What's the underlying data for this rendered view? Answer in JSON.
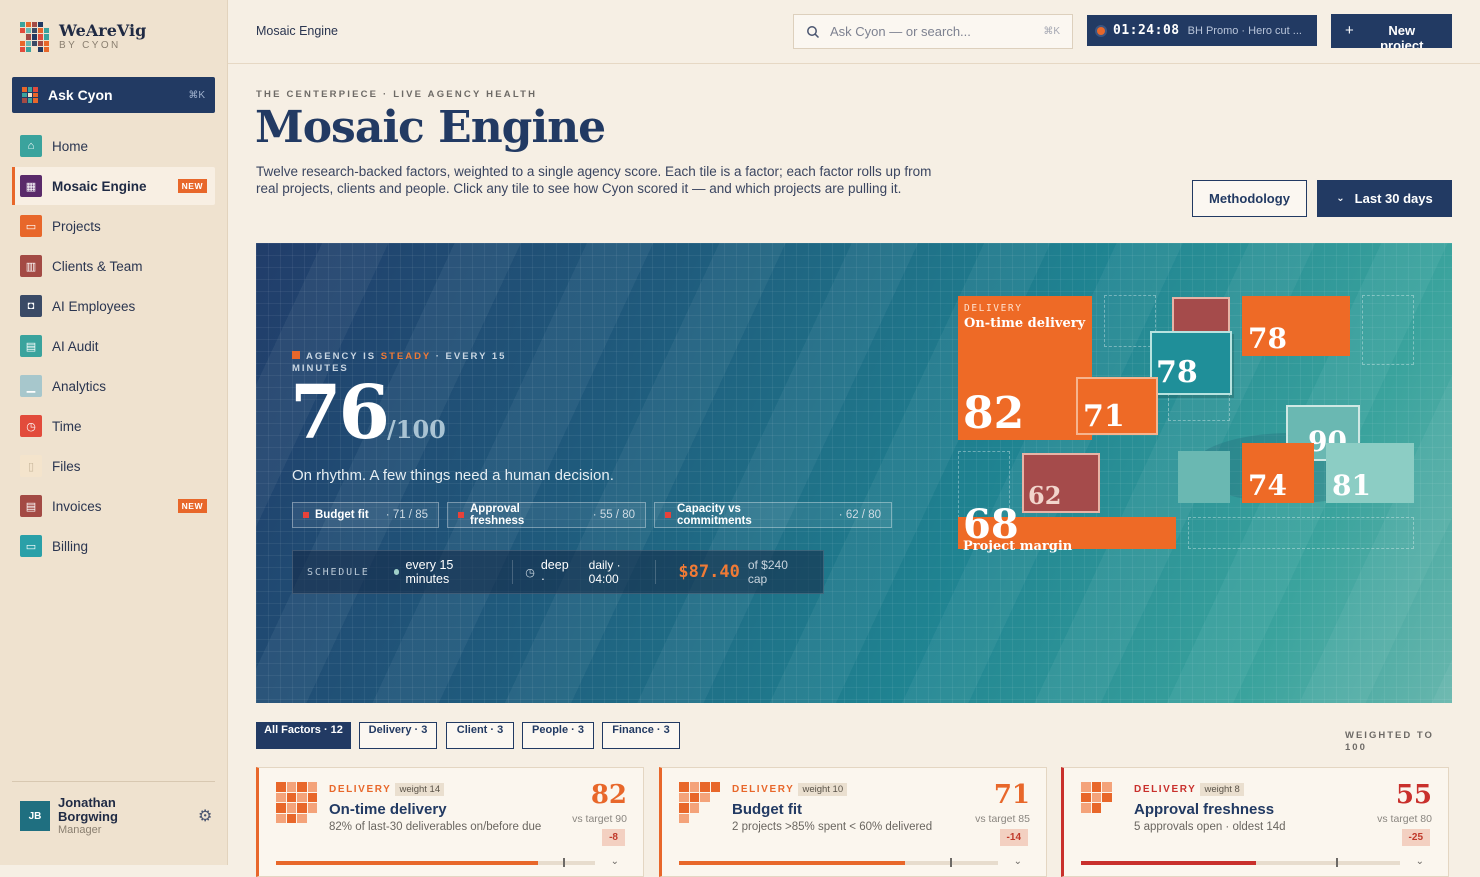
{
  "brand": {
    "name": "WeAreVig",
    "sub": "BY CYON"
  },
  "ask": {
    "label": "Ask Cyon",
    "shortcut": "⌘K"
  },
  "nav": [
    {
      "label": "Home",
      "icon": "home-icon",
      "color": "#3aa39d"
    },
    {
      "label": "Mosaic Engine",
      "icon": "grid-icon",
      "color": "#5a2a6a",
      "badge": "NEW",
      "active": true
    },
    {
      "label": "Projects",
      "icon": "folder-icon",
      "color": "#e8672a"
    },
    {
      "label": "Clients & Team",
      "icon": "building-icon",
      "color": "#a34a44"
    },
    {
      "label": "AI Employees",
      "icon": "robot-icon",
      "color": "#3a4a66"
    },
    {
      "label": "AI Audit",
      "icon": "audit-icon",
      "color": "#3aa39d"
    },
    {
      "label": "Analytics",
      "icon": "chart-icon",
      "color": "#a7c7cc"
    },
    {
      "label": "Time",
      "icon": "clock-icon",
      "color": "#e24b3b"
    },
    {
      "label": "Files",
      "icon": "file-icon",
      "color": "#f4e4cc"
    },
    {
      "label": "Invoices",
      "icon": "invoice-icon",
      "color": "#a34a44",
      "badge": "NEW"
    },
    {
      "label": "Billing",
      "icon": "card-icon",
      "color": "#2aa0a8"
    }
  ],
  "user": {
    "initials": "JB",
    "name": "Jonathan Borgwing",
    "role": "Manager"
  },
  "topbar": {
    "breadcrumb": "Mosaic Engine",
    "search_placeholder": "Ask Cyon — or search...",
    "search_shortcut": "⌘K",
    "timer_time": "01:24:08",
    "timer_task": "BH Promo · Hero cut ...",
    "new_project_plus": "+",
    "new_project_label": "New project"
  },
  "header": {
    "eyebrow": "THE CENTERPIECE · LIVE AGENCY HEALTH",
    "title": "Mosaic Engine",
    "intro": "Twelve research-backed factors, weighted to a single agency score. Each tile is a factor; each factor rolls up from real projects, clients and people. Click any tile to see how Cyon scored it — and which projects are pulling it.",
    "methodology": "Methodology",
    "range": "Last 30 days"
  },
  "hero": {
    "status_prefix": "AGENCY IS",
    "status_word": "STEADY",
    "status_suffix": "· EVERY 15 MINUTES",
    "score": "76",
    "score_den": "/100",
    "tagline": "On rhythm. A few things need a human decision.",
    "chips": [
      {
        "name": "Budget fit",
        "value": "· 71  /  85"
      },
      {
        "name": "Approval freshness",
        "value": "· 55  /  80"
      },
      {
        "name": "Capacity vs commitments",
        "value": "· 62  /  80"
      }
    ],
    "schedule": {
      "label": "SCHEDULE",
      "frequency": "every 15 minutes",
      "mode": "deep",
      "mode_dot": "·",
      "daily": "daily · 04:00",
      "cost": "$87.40",
      "cap": "of $240 cap"
    },
    "tiles": {
      "delivery_kicker": "DELIVERY",
      "delivery_title": "On-time delivery",
      "delivery_score": "82",
      "budget_score": "71",
      "teal_score": "78",
      "orange_score": "78",
      "light_score": "90",
      "orange2_score": "74",
      "mint_score": "81",
      "red_score": "62",
      "margin_score": "68",
      "margin_label": "Project margin"
    }
  },
  "filters": [
    {
      "label": "All Factors · 12",
      "active": true
    },
    {
      "label": "Delivery · 3"
    },
    {
      "label": "Client · 3"
    },
    {
      "label": "People · 3"
    },
    {
      "label": "Finance · 3"
    }
  ],
  "weighted_label": "WEIGHTED TO 100",
  "cards": [
    {
      "kicker": "DELIVERY",
      "weight": "weight 14",
      "title": "On-time delivery",
      "sub": "82% of last-30 deliverables on/before due",
      "score": "82",
      "target": "vs target 90",
      "delta": "-8",
      "fill": 0.82,
      "target_frac": 0.9,
      "color": "#e8672a"
    },
    {
      "kicker": "DELIVERY",
      "weight": "weight 10",
      "title": "Budget fit",
      "sub": "2 projects >85% spent < 60% delivered",
      "score": "71",
      "target": "vs target 85",
      "delta": "-14",
      "fill": 0.71,
      "target_frac": 0.85,
      "color": "#e8672a"
    },
    {
      "kicker": "DELIVERY",
      "weight": "weight 8",
      "title": "Approval freshness",
      "sub": "5 approvals open · oldest 14d",
      "score": "55",
      "target": "vs target 80",
      "delta": "-25",
      "fill": 0.55,
      "target_frac": 0.8,
      "color": "#c9302c"
    }
  ]
}
